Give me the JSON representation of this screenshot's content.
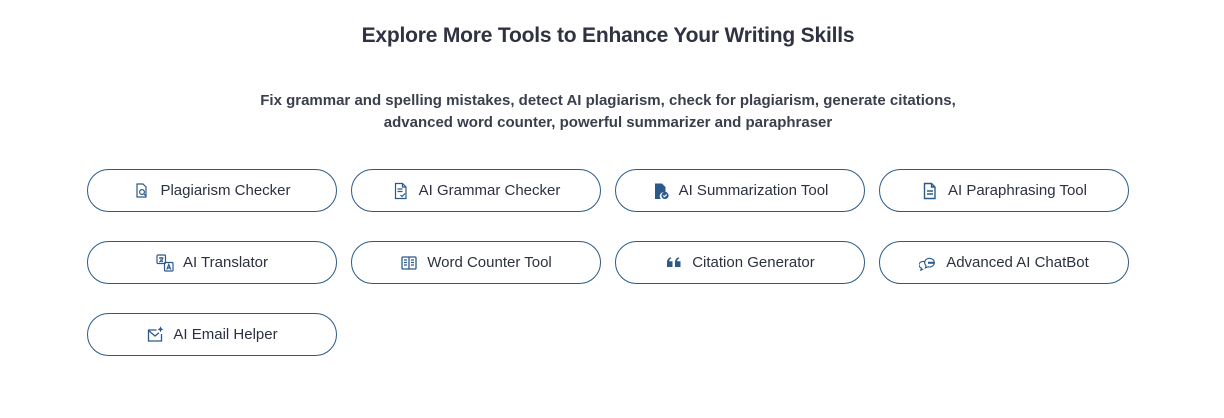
{
  "header": {
    "title": "Explore More Tools to Enhance Your Writing Skills",
    "description_line1": "Fix grammar and spelling mistakes, detect AI plagiarism, check for plagiarism, generate citations,",
    "description_line2": "advanced word counter, powerful summarizer and paraphraser"
  },
  "colors": {
    "border": "#2b5a8a",
    "icon": "#2b5a8a",
    "text": "#2c3140"
  },
  "tools": [
    {
      "label": "Plagiarism Checker",
      "icon": "search-document-icon"
    },
    {
      "label": "AI Grammar Checker",
      "icon": "document-check-icon"
    },
    {
      "label": "AI Summarization Tool",
      "icon": "file-check-icon"
    },
    {
      "label": "AI Paraphrasing Tool",
      "icon": "document-lines-icon"
    },
    {
      "label": "AI Translator",
      "icon": "translate-icon"
    },
    {
      "label": "Word Counter Tool",
      "icon": "book-icon"
    },
    {
      "label": "Citation Generator",
      "icon": "quote-icon"
    },
    {
      "label": "Advanced AI ChatBot",
      "icon": "chat-bubbles-icon"
    },
    {
      "label": "AI Email Helper",
      "icon": "envelope-star-icon"
    }
  ]
}
